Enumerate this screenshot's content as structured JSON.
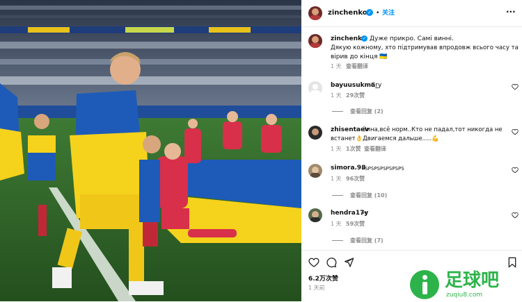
{
  "post": {
    "username": "zinchenko",
    "follow_label": "关注",
    "more_label": "···",
    "caption_user": "zinchenko",
    "caption_line1": "Дуже прикро. Самі винні.",
    "caption_line2": "Дякую кожному, хто підтримував впродовж всього часу та",
    "caption_line3": "вірив до кінця 🇺🇦",
    "caption_time": "1 天",
    "caption_translate": "查看翻译"
  },
  "comments": [
    {
      "user": "bayuusukma_",
      "text": "Cry",
      "time": "1 天",
      "likes": "29次赞",
      "replies": "查看回复 (2)"
    },
    {
      "user": "zhisentaev",
      "text1": "Зина,всё норм..Кто не падал,тот никогда не",
      "text2": "встанет👌Двигаемся дальше.....💪",
      "time": "1 天",
      "likes": "1次赞",
      "translate": "查看翻译"
    },
    {
      "user": "simora.98",
      "text": "PSPSPSPSPSPSPS",
      "time": "1 天",
      "likes": "96次赞",
      "replies": "查看回复 (10)"
    },
    {
      "user": "hendra17y",
      "text": "PS",
      "time": "1 天",
      "likes": "59次赞",
      "replies": "查看回复 (7)"
    }
  ],
  "footer": {
    "likes_count": "6.2万次赞",
    "posted": "1 天前"
  },
  "watermark": {
    "brand": "足球吧",
    "url": "zuqiu8.com"
  },
  "colors": {
    "accent": "#0095f6",
    "ukraine_blue": "#1e5bb8",
    "ukraine_yellow": "#f5d21c",
    "brand_green": "#2db34a"
  }
}
